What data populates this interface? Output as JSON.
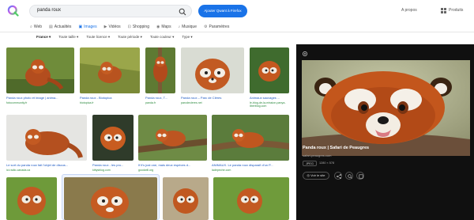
{
  "search": {
    "query": "panda roux"
  },
  "header": {
    "firefox_button": "Ajouter Qwant à Firefox",
    "about_link": "A propos",
    "products_link": "Produits"
  },
  "tabs": [
    {
      "label": "Web",
      "icon": "search-icon"
    },
    {
      "label": "Actualités",
      "icon": "newspaper-icon"
    },
    {
      "label": "Images",
      "icon": "image-icon",
      "active": true
    },
    {
      "label": "Vidéos",
      "icon": "play-icon"
    },
    {
      "label": "Shopping",
      "icon": "cart-icon"
    },
    {
      "label": "Maps",
      "icon": "map-pin-icon"
    },
    {
      "label": "Musique",
      "icon": "music-icon"
    },
    {
      "label": "Paramètres",
      "icon": "settings-icon"
    }
  ],
  "filters": [
    {
      "label": "France ▾"
    },
    {
      "label": "Toute taille ▾"
    },
    {
      "label": "Toute licence ▾"
    },
    {
      "label": "Toute période ▾"
    },
    {
      "label": "Toute couleur ▾"
    },
    {
      "label": "Type ▾"
    }
  ],
  "results": [
    {
      "caption": "Panda roux photo et image | anima...",
      "source": "fotocommunity.fr"
    },
    {
      "caption": "Panda roux - Biotopica",
      "source": "biotopica.fr"
    },
    {
      "caption": "Panda roux, T...",
      "source": "panda.fr"
    },
    {
      "caption": "Panda roux – Parc de Clères",
      "source": "parcdecleres.net"
    },
    {
      "caption": "Animaux sauvages ...",
      "source": "le-blog-de-la-mission-panya-liberblog.com"
    },
    {
      "caption": "Le sort du panda roux fait l'objet de discus...",
      "source": "ici.radio-canada.ca"
    },
    {
      "caption": "Panda roux - les pro...",
      "source": "kittysblog.com"
    },
    {
      "caption": "If it's just one, mais deux espèces d...",
      "source": "goodwill.org"
    },
    {
      "caption": "ANIMAUX. Le panda roux disparaît d'un P...",
      "source": "ladepeche.com"
    },
    {
      "caption": "",
      "source": ""
    },
    {
      "caption": "",
      "source": ""
    },
    {
      "caption": "",
      "source": ""
    },
    {
      "caption": "",
      "source": ""
    },
    {
      "caption": "",
      "source": ""
    }
  ],
  "preview": {
    "title": "Panda roux | Safari de Peaugres",
    "site": "safari-peaugres.com",
    "format": "JPEG",
    "dimensions": "1280 × 578",
    "visit_label": "Voir le site"
  },
  "colors": {
    "accent": "#1a73e8",
    "panel_bg": "#101010",
    "source_green": "#2b8a3e"
  }
}
